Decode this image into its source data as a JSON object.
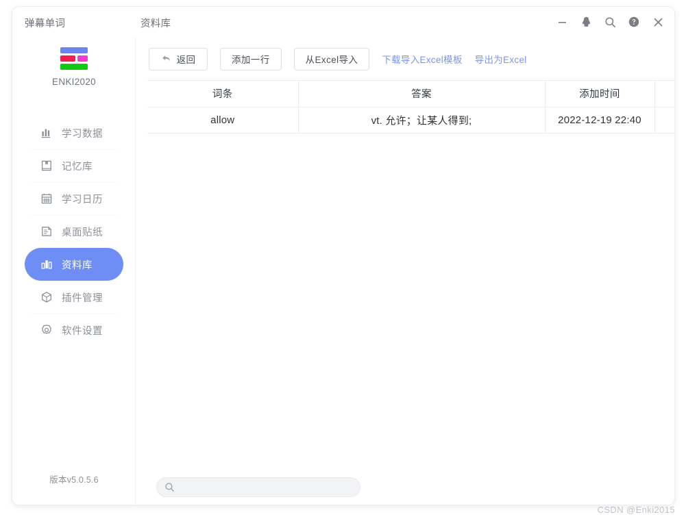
{
  "window": {
    "app_title": "弹幕单词",
    "page_title": "资料库",
    "controls": [
      {
        "name": "minimize",
        "icon": "minimize-icon"
      },
      {
        "name": "qq",
        "icon": "qq-penguin-icon"
      },
      {
        "name": "search",
        "icon": "search-icon"
      },
      {
        "name": "help",
        "icon": "help-circle-icon"
      },
      {
        "name": "close",
        "icon": "close-icon"
      }
    ]
  },
  "sidebar": {
    "logo_label": "ENKI2020",
    "logo_colors": {
      "blue": "#6b86f0",
      "red": "#f2204f",
      "pink": "#f03ad0",
      "green": "#12c916"
    },
    "active_color": "#6f8ef5",
    "items": [
      {
        "label": "学习数据",
        "icon": "bar-chart-icon",
        "active": false
      },
      {
        "label": "记忆库",
        "icon": "book-icon",
        "active": false
      },
      {
        "label": "学习日历",
        "icon": "calendar-icon",
        "active": false
      },
      {
        "label": "桌面贴纸",
        "icon": "sticky-note-icon",
        "active": false
      },
      {
        "label": "资料库",
        "icon": "database-bars-icon",
        "active": true
      },
      {
        "label": "插件管理",
        "icon": "cube-icon",
        "active": false
      },
      {
        "label": "软件设置",
        "icon": "gear-icon",
        "active": false
      }
    ],
    "version": "版本v5.0.5.6"
  },
  "toolbar": {
    "back_label": "返回",
    "add_row_label": "添加一行",
    "import_excel_label": "从Excel导入",
    "download_template_label": "下载导入Excel模板",
    "export_excel_label": "导出为Excel",
    "link_color": "#7b94f0"
  },
  "table": {
    "columns": [
      "词条",
      "答案",
      "添加时间",
      ""
    ],
    "rows": [
      [
        "allow",
        "vt. 允许；让某人得到;",
        "2022-12-19 22:40",
        ""
      ]
    ]
  },
  "search": {
    "value": "",
    "placeholder": ""
  },
  "watermark": "CSDN @Enki2015"
}
